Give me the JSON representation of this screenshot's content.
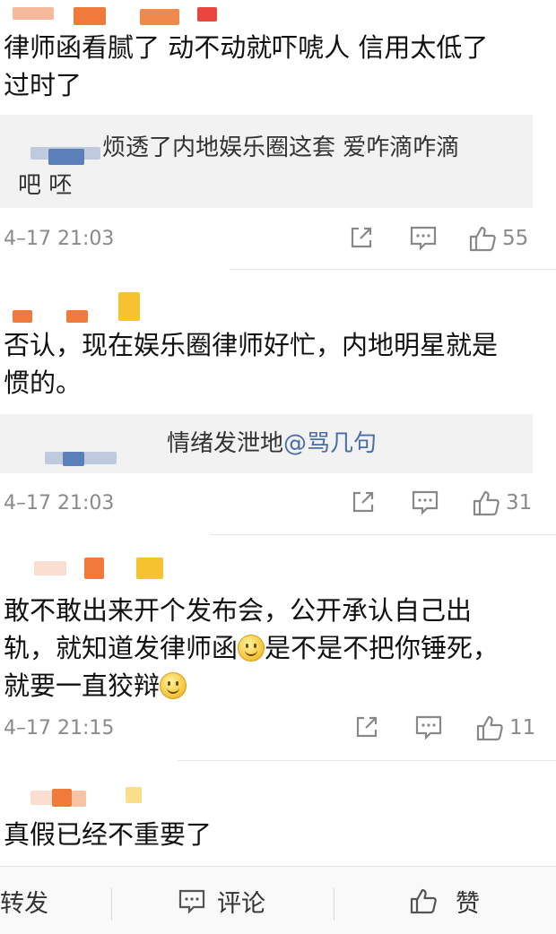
{
  "comments": [
    {
      "text_lines": [
        "律师函看腻了  动不动就吓唬人  信用太低了",
        "过时了"
      ],
      "reply": {
        "line1": "烦透了内地娱乐圈这套  爱咋滴咋滴",
        "line2": "吧 呸"
      },
      "time": "4–17 21:03",
      "likes": "55"
    },
    {
      "text_lines": [
        "否认，现在娱乐圈律师好忙，内地明星就是",
        "惯的。"
      ],
      "reply": {
        "line1_prefix": "情绪发泄地",
        "line1_mention": "@骂几句"
      },
      "time": "4–17 21:03",
      "likes": "31"
    },
    {
      "text_lines": [
        "敢不敢出来开个发布会，公开承认自己出",
        "轨，就知道发律师函",
        "是不是不把你锤死，",
        "就要一直狡辩"
      ],
      "time": "4–17 21:15",
      "likes": "11"
    },
    {
      "text_lines": [
        "真假已经不重要了"
      ]
    }
  ],
  "bottom_bar": {
    "repost_label": "转发",
    "comment_label": "评论",
    "like_label": "赞"
  },
  "colors": {
    "mention": "#4a6ea9",
    "meta": "#8a8a8a",
    "quote_bg": "#f2f2f2",
    "blur_orange": "#f07a3c",
    "blur_red": "#e8453c",
    "blur_yellow": "#f6c22e",
    "blur_blue": "#5b7fb8"
  },
  "icons": [
    "share-icon",
    "comment-icon",
    "thumbs-up-icon",
    "emoji-smile-icon"
  ]
}
